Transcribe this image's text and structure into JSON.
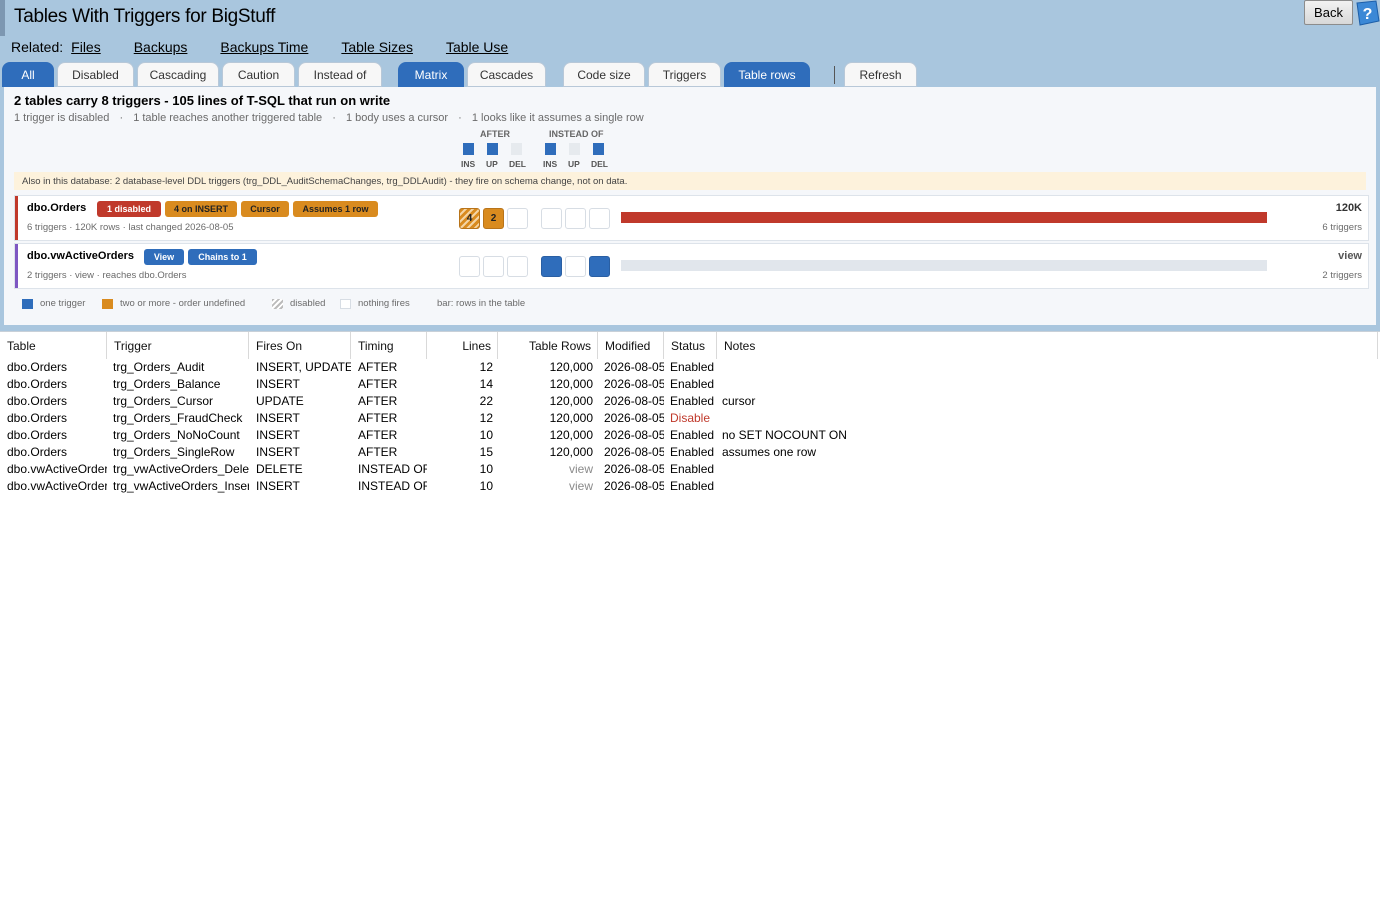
{
  "window": {
    "title": "Tables With Triggers for BigStuff",
    "back_label": "Back"
  },
  "related": {
    "label": "Related:",
    "links": [
      "Files",
      "Backups",
      "Backups Time",
      "Table Sizes",
      "Table Use"
    ]
  },
  "filters": {
    "group1": [
      {
        "label": "All",
        "active": true
      },
      {
        "label": "Disabled",
        "active": false
      },
      {
        "label": "Cascading",
        "active": false
      },
      {
        "label": "Caution",
        "active": false
      },
      {
        "label": "Instead of",
        "active": false
      }
    ],
    "group2": [
      {
        "label": "Matrix",
        "active": true
      },
      {
        "label": "Cascades",
        "active": false
      }
    ],
    "group3": [
      {
        "label": "Code size",
        "active": false
      },
      {
        "label": "Triggers",
        "active": false
      },
      {
        "label": "Table rows",
        "active": true
      }
    ],
    "refresh_label": "Refresh"
  },
  "summary": {
    "headline": "2 tables carry 8 triggers - 105 lines of T-SQL that run on write",
    "facts": [
      "1 trigger is disabled",
      "1 table reaches another triggered table",
      "1 body uses a cursor",
      "1 looks like it assumes a single row"
    ],
    "fact_separator": "·"
  },
  "matrix_legend": {
    "after_label": "AFTER",
    "instead_label": "INSTEAD OF",
    "after_cols": [
      "INS",
      "UP",
      "DEL"
    ],
    "instead_cols": [
      "INS",
      "UP",
      "DEL"
    ]
  },
  "ddl_note": "Also in this database: 2 database-level DDL triggers (trg_DDL_AuditSchemaChanges, trg_DDLAudit) - they fire on schema change, not on data.",
  "cards": [
    {
      "name": "dbo.Orders",
      "badges": [
        "1 disabled",
        "4 on INSERT",
        "Cursor",
        "Assumes 1 row"
      ],
      "subtitle": "6 triggers · 120K rows · last changed 2026-08-05",
      "after": [
        "4",
        "2",
        ""
      ],
      "instead": [
        "",
        "",
        ""
      ],
      "bar_fraction": 1.0,
      "right_value": "120K",
      "right_sub": "6 triggers"
    },
    {
      "name": "dbo.vwActiveOrders",
      "badges": [
        "View",
        "Chains to 1"
      ],
      "subtitle": "2 triggers · view · reaches dbo.Orders",
      "after": [
        "",
        "",
        ""
      ],
      "instead": [
        "",
        "",
        ""
      ],
      "bar_fraction": 0.0,
      "right_value": "view",
      "right_sub": "2 triggers"
    }
  ],
  "legend": {
    "one_trigger": "one trigger",
    "two_or_more": "two or more - order undefined",
    "disabled": "disabled",
    "nothing": "nothing fires",
    "bar_note": "bar: rows in the table"
  },
  "colors": {
    "blue": "#2f6dbb",
    "orange": "#d98b1f",
    "red": "#c0392b",
    "purple": "#7e57c2",
    "empty": "#e6eaee"
  },
  "grid": {
    "columns": [
      "Table",
      "Trigger",
      "Fires On",
      "Timing",
      "Lines",
      "Table Rows",
      "Modified",
      "Status",
      "Notes"
    ],
    "rows": [
      [
        "dbo.Orders",
        "trg_Orders_Audit",
        "INSERT, UPDATE",
        "AFTER",
        "12",
        "120,000",
        "2026-08-05",
        "Enabled",
        ""
      ],
      [
        "dbo.Orders",
        "trg_Orders_Balance",
        "INSERT",
        "AFTER",
        "14",
        "120,000",
        "2026-08-05",
        "Enabled",
        ""
      ],
      [
        "dbo.Orders",
        "trg_Orders_Cursor",
        "UPDATE",
        "AFTER",
        "22",
        "120,000",
        "2026-08-05",
        "Enabled",
        "cursor"
      ],
      [
        "dbo.Orders",
        "trg_Orders_FraudCheck",
        "INSERT",
        "AFTER",
        "12",
        "120,000",
        "2026-08-05",
        "Disable",
        ""
      ],
      [
        "dbo.Orders",
        "trg_Orders_NoNoCount",
        "INSERT",
        "AFTER",
        "10",
        "120,000",
        "2026-08-05",
        "Enabled",
        "no SET NOCOUNT ON"
      ],
      [
        "dbo.Orders",
        "trg_Orders_SingleRow",
        "INSERT",
        "AFTER",
        "15",
        "120,000",
        "2026-08-05",
        "Enabled",
        "assumes one row"
      ],
      [
        "dbo.vwActiveOrders",
        "trg_vwActiveOrders_Delete",
        "DELETE",
        "INSTEAD OF",
        "10",
        "view",
        "2026-08-05",
        "Enabled",
        ""
      ],
      [
        "dbo.vwActiveOrders",
        "trg_vwActiveOrders_Insert",
        "INSERT",
        "INSTEAD OF",
        "10",
        "view",
        "2026-08-05",
        "Enabled",
        ""
      ]
    ]
  }
}
